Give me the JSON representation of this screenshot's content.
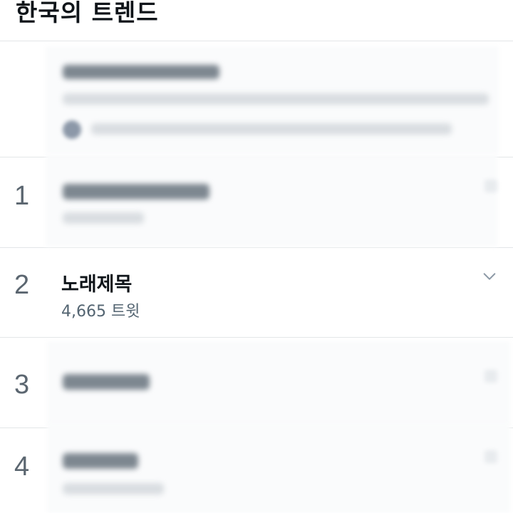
{
  "header": {
    "title": "한국의 트렌드"
  },
  "trends": [
    {
      "rank": "1",
      "blurred": true
    },
    {
      "rank": "2",
      "title": "노래제목",
      "tweet_count": "4,665 트윗",
      "blurred": false
    },
    {
      "rank": "3",
      "blurred": true
    },
    {
      "rank": "4",
      "blurred": true
    }
  ],
  "icons": {
    "more": "chevron-down-icon"
  },
  "colors": {
    "text_primary": "#0f1419",
    "text_secondary": "#536471",
    "divider": "#e3e6e8"
  }
}
